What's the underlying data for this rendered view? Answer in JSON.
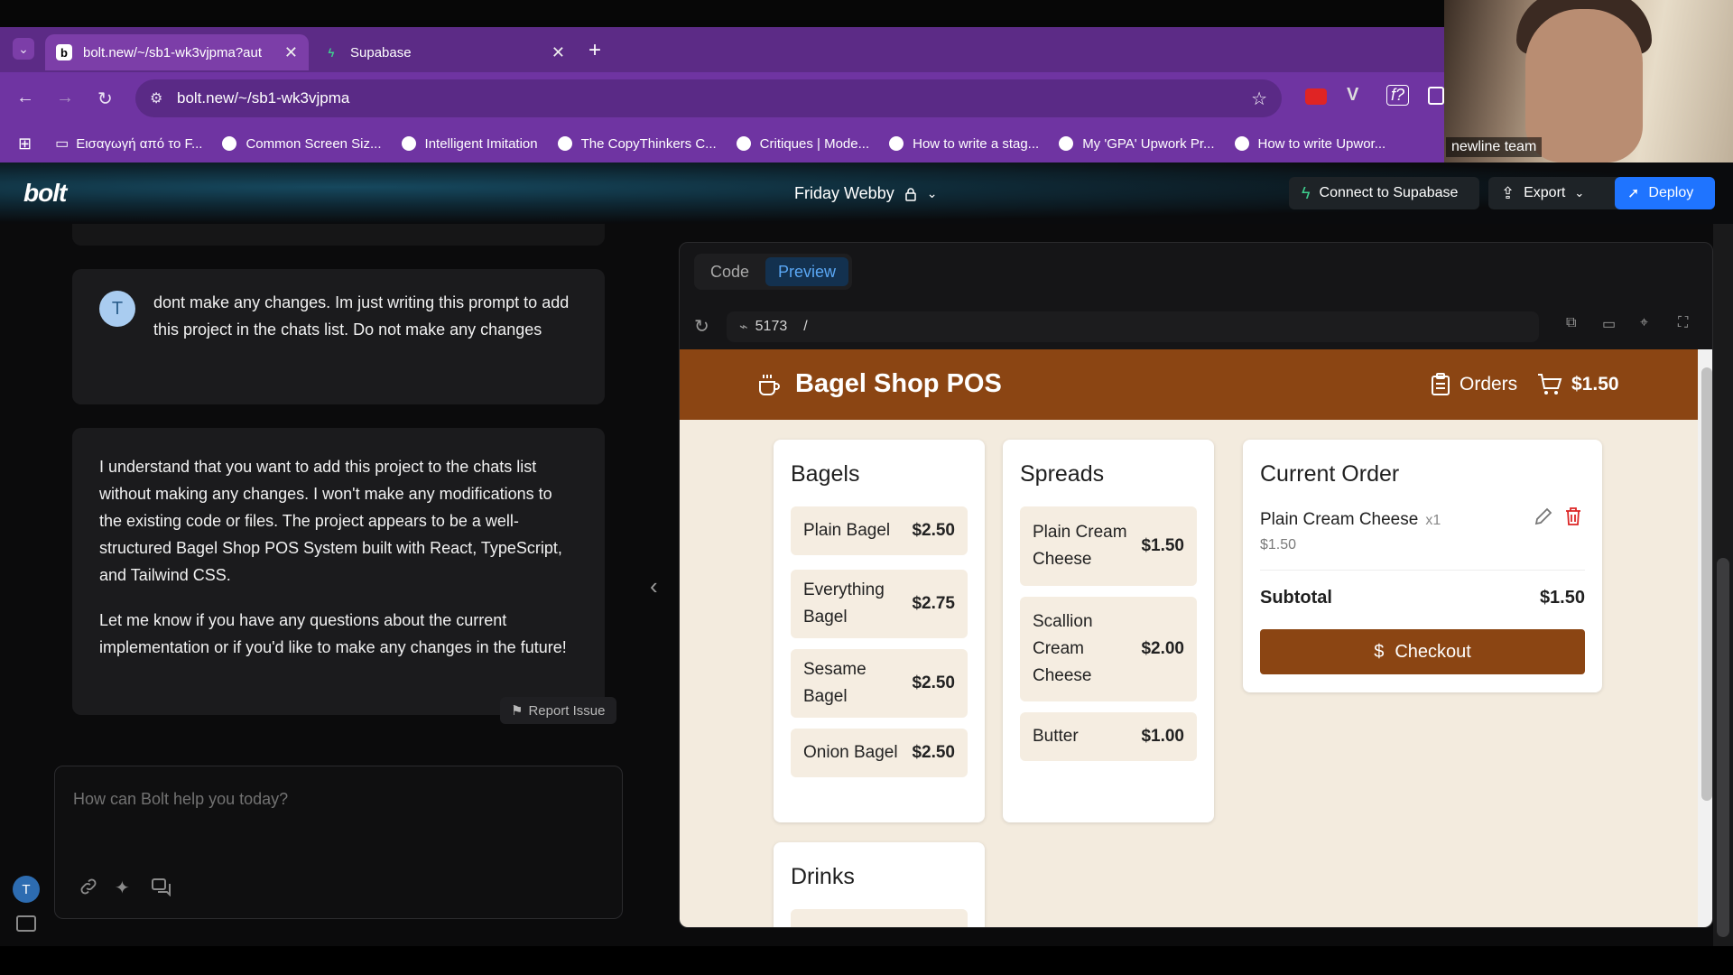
{
  "browser": {
    "tabs": [
      {
        "title": "bolt.new/~/sb1-wk3vjpma?aut",
        "favicon": "b"
      },
      {
        "title": "Supabase",
        "favicon": "supabase-icon"
      }
    ],
    "url": "bolt.new/~/sb1-wk3vjpma",
    "bookmarks": [
      "Εισαγωγή από το F...",
      "Common Screen Siz...",
      "Intelligent Imitation",
      "The CopyThinkers C...",
      "Critiques | Mode...",
      "How to write a stag...",
      "My 'GPA' Upwork Pr...",
      "How to write Upwor..."
    ]
  },
  "webcam": {
    "label": "newline team"
  },
  "bolt": {
    "logo": "bolt",
    "project_name": "Friday Webby",
    "connect_supabase": "Connect to Supabase",
    "export": "Export",
    "deploy": "Deploy"
  },
  "chat": {
    "user_initial": "T",
    "user_message": "dont make any changes. Im just writing this prompt to add this project in the chats list. Do not make any changes",
    "assistant_p1": "I understand that you want to add this project to the chats list without making any changes. I won't make any modifications to the existing code or files. The project appears to be a well-structured Bagel Shop POS System built with React, TypeScript, and Tailwind CSS.",
    "assistant_p2": "Let me know if you have any questions about the current implementation or if you'd like to make any changes in the future!",
    "report_issue": "Report Issue",
    "input_placeholder": "How can Bolt help you today?",
    "sidebar_avatar": "T"
  },
  "preview": {
    "tab_code": "Code",
    "tab_preview": "Preview",
    "port": "5173",
    "path": "/"
  },
  "app": {
    "title": "Bagel Shop POS",
    "orders_label": "Orders",
    "cart_total": "$1.50",
    "accent_color": "#8b4513",
    "categories": [
      {
        "name": "Bagels",
        "items": [
          {
            "name": "Plain Bagel",
            "price": "$2.50"
          },
          {
            "name": "Everything Bagel",
            "price": "$2.75"
          },
          {
            "name": "Sesame Bagel",
            "price": "$2.50"
          },
          {
            "name": "Onion Bagel",
            "price": "$2.50"
          }
        ]
      },
      {
        "name": "Spreads",
        "items": [
          {
            "name": "Plain Cream Cheese",
            "price": "$1.50"
          },
          {
            "name": "Scallion Cream Cheese",
            "price": "$2.00"
          },
          {
            "name": "Butter",
            "price": "$1.00"
          }
        ]
      },
      {
        "name": "Drinks",
        "items": []
      }
    ],
    "order": {
      "title": "Current Order",
      "item_name": "Plain Cream Cheese",
      "item_qty": "x1",
      "item_price": "$1.50",
      "subtotal_label": "Subtotal",
      "subtotal_value": "$1.50",
      "checkout_label": "Checkout"
    }
  }
}
